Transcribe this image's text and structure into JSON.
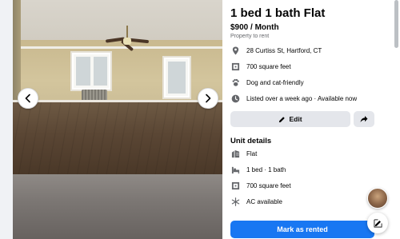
{
  "listing": {
    "title": "1 bed 1 bath Flat",
    "price": "$900 / Month",
    "subtitle": "Property to rent",
    "address": "28 Curtiss St, Hartford, CT",
    "size": "700 square feet",
    "pets": "Dog and cat-friendly",
    "listed": "Listed over a week ago · Available now"
  },
  "actions": {
    "edit_label": "Edit",
    "mark_rented_label": "Mark as rented"
  },
  "unit_details": {
    "heading": "Unit details",
    "items": [
      {
        "label": "Flat",
        "icon": "building-icon"
      },
      {
        "label": "1 bed · 1 bath",
        "icon": "bed-icon"
      },
      {
        "label": "700 square feet",
        "icon": "ruler-icon"
      },
      {
        "label": "AC available",
        "icon": "snowflake-icon"
      }
    ]
  },
  "colors": {
    "accent": "#1877f2",
    "button_gray": "#e4e6eb",
    "text_secondary": "#65676b"
  }
}
